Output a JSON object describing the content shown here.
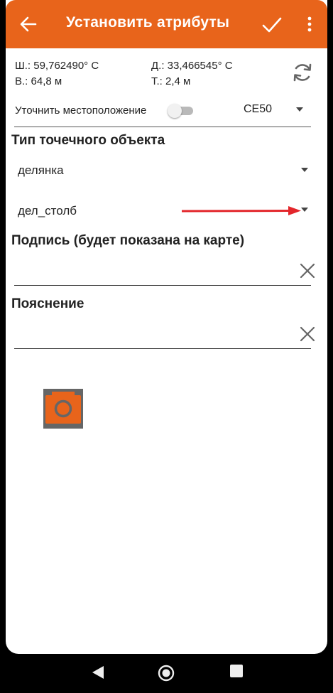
{
  "appbar": {
    "title": "Установить атрибуты",
    "back_icon": "arrow-left-icon",
    "confirm_icon": "check-icon",
    "more_icon": "more-vertical-icon",
    "color": "#e8641b"
  },
  "location": {
    "lat": "Ш.: 59,762490° С",
    "lon": "Д.: 33,466545° С",
    "alt": "В.: 64,8 м",
    "accuracy": "Т.: 2,4 м",
    "refresh_icon": "refresh-icon",
    "refine_label": "Уточнить местоположение",
    "refine_enabled": false,
    "precision_value": "CE50"
  },
  "point_type": {
    "title": "Тип точечного объекта",
    "category_value": "делянка",
    "subtype_value": "дел_столб"
  },
  "caption": {
    "title": "Подпись (будет показана на карте)",
    "value": ""
  },
  "note": {
    "title": "Пояснение",
    "value": ""
  },
  "photo": {
    "icon": "camera-icon"
  },
  "annotation": {
    "arrow_color": "#e3262b"
  }
}
